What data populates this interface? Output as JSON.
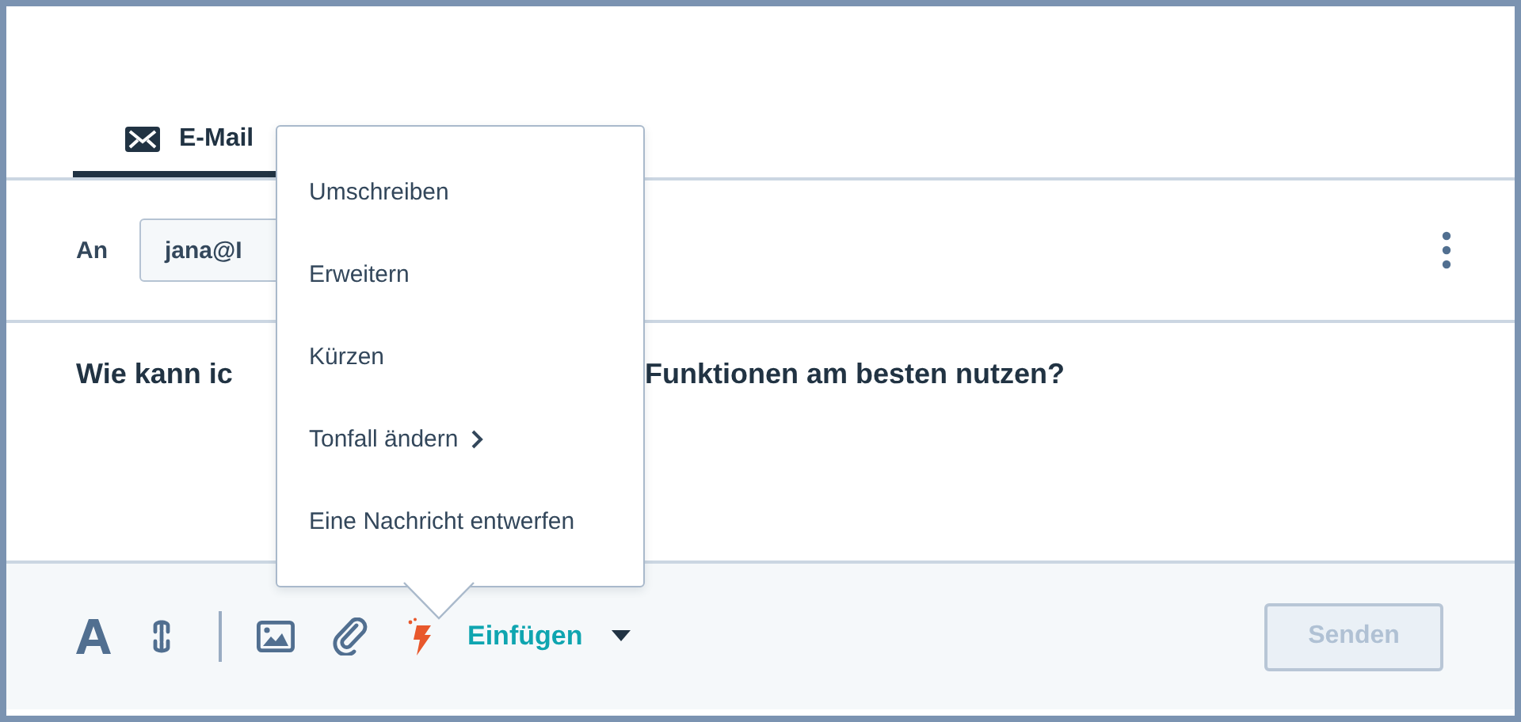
{
  "tabs": [
    {
      "label": "E-Mail",
      "selected": true
    }
  ],
  "recipient": {
    "label": "An",
    "value": "jana@I"
  },
  "subject": {
    "parts": [
      "Wie kann ic",
      "Funktionen am besten nutzen?"
    ]
  },
  "toolbar": {
    "insert_label": "Einfügen"
  },
  "send_button": {
    "label": "Senden",
    "disabled": true
  },
  "menu": {
    "items": [
      {
        "label": "Umschreiben",
        "submenu": false
      },
      {
        "label": "Erweitern",
        "submenu": false
      },
      {
        "label": "Kürzen",
        "submenu": false
      },
      {
        "label": "Tonfall ändern",
        "submenu": true
      },
      {
        "label": "Eine Nachricht entwerfen",
        "submenu": false
      }
    ]
  }
}
